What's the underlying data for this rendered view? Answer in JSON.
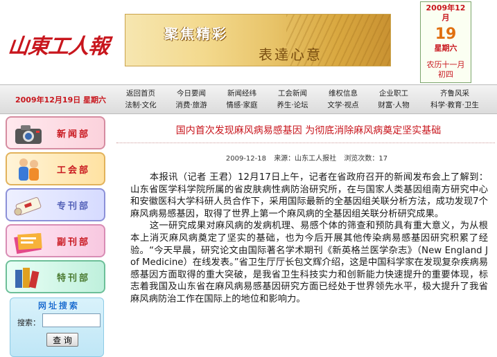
{
  "header": {
    "logo_text": "山東工人報",
    "banner_line1": "聚焦精彩",
    "banner_line2": "表達心意",
    "date_box": {
      "year_month": "2009年12月",
      "day": "19",
      "weekday": "星期六",
      "lunar": "农历十一月初四"
    }
  },
  "nav": {
    "date_text": "2009年12月19日 星期六",
    "columns": [
      {
        "top": "返回首页",
        "bottom": "法制·文化"
      },
      {
        "top": "今日要闻",
        "bottom": "消费·旅游"
      },
      {
        "top": "新闻经纬",
        "bottom": "情感·家庭"
      },
      {
        "top": "工会新闻",
        "bottom": "养生·论坛"
      },
      {
        "top": "维权信息",
        "bottom": "文学·视点"
      },
      {
        "top": "企业职工",
        "bottom": "财富·人物"
      },
      {
        "top": "齐鲁风采",
        "bottom": "科学·教育·卫生"
      }
    ]
  },
  "sidebar": {
    "items": [
      {
        "label": "新闻部",
        "icon": "camera-icon"
      },
      {
        "label": "工会部",
        "icon": "people-icon"
      },
      {
        "label": "专刊部",
        "icon": "scroll-icon"
      },
      {
        "label": "副刊部",
        "icon": "magazine-icon"
      },
      {
        "label": "特刊部",
        "icon": "books-icon"
      }
    ],
    "search": {
      "title": "网址搜索",
      "label": "搜索：",
      "value": "",
      "button": "查 询"
    }
  },
  "article": {
    "title": "国内首次发现麻风病易感基因 为彻底消除麻风病奠定坚实基础",
    "date": "2009-12-18",
    "source": "来源：山东工人报社",
    "views": "浏览次数：17",
    "paragraphs": [
      "本报讯（记者 王君）12月17日上午，记者在省政府召开的新闻发布会上了解到：山东省医学科学院所属的省皮肤病性病防治研究所，在与国家人类基因组南方研究中心和安徽医科大学科研人员合作下，采用国际最新的全基因组关联分析方法，成功发现7个麻风病易感基因，取得了世界上第一个麻风病的全基因组关联分析研究成果。",
      "这一研究成果对麻风病的发病机理、易感个体的筛查和预防具有重大意义，为从根本上消灭麻风病奠定了坚实的基础，也为今后开展其他传染病易感基因研究积累了经验。“今天早晨，研究论文由国际著名学术期刊《新英格兰医学杂志》（New England J of Medicine）在线发表。”省卫生厅厅长包文辉介绍，这是中国科学家在发现复杂疾病易感基因方面取得的重大突破，是我省卫生科技实力和创新能力快速提升的重要体现，标志着我国及山东省在麻风病易感基因研究方面已经处于世界领先水平，极大提升了我省麻风病防治工作在国际上的地位和影响力。"
    ]
  },
  "colors": {
    "brand_red": "#c8161d",
    "nav_bg": "#dcdcdc"
  }
}
